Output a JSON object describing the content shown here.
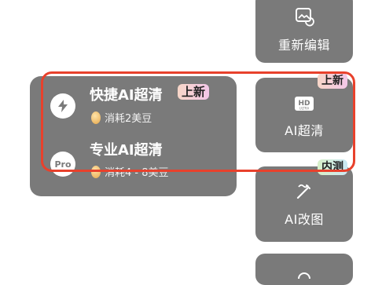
{
  "side_menu": {
    "items": [
      {
        "label": "重新编辑",
        "icon": "image-edit-icon"
      },
      {
        "label": "AI超清",
        "icon": "hd-icon",
        "badge": "上新"
      },
      {
        "label": "AI改图",
        "icon": "magic-wand-icon",
        "badge": "内测"
      },
      {
        "label": "",
        "icon": "partial-icon"
      }
    ]
  },
  "upscale_panel": {
    "options": [
      {
        "title": "快捷AI超清",
        "badge": "上新",
        "cost": "消耗2美豆",
        "icon": "lightning-icon"
      },
      {
        "title": "专业AI超清",
        "cost": "消耗4 - 8美豆",
        "icon": "pro-icon",
        "icon_text": "Pro"
      }
    ]
  },
  "hd_icon_text": {
    "top": "HD",
    "bottom": "ULTRA"
  },
  "colors": {
    "panel": "#7a7a7a",
    "highlight": "#e8412c",
    "badge_new": "#f3c7e8",
    "badge_beta": "#c8e8f5"
  }
}
